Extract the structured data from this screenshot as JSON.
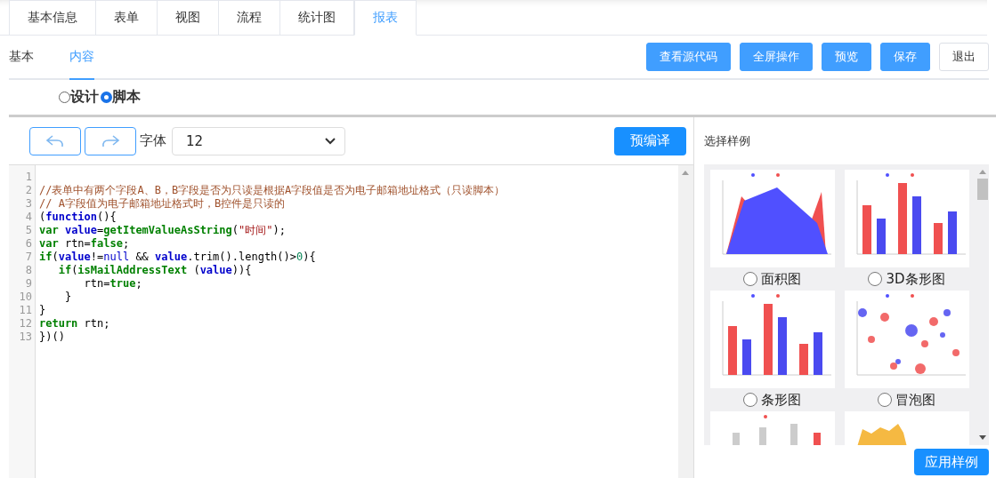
{
  "tabs": [
    {
      "label": "基本信息",
      "selected": false
    },
    {
      "label": "表单",
      "selected": false
    },
    {
      "label": "视图",
      "selected": false
    },
    {
      "label": "流程",
      "selected": false
    },
    {
      "label": "统计图",
      "selected": false
    },
    {
      "label": "报表",
      "selected": true
    }
  ],
  "subtabs": [
    {
      "label": "基本",
      "selected": false
    },
    {
      "label": "内容",
      "selected": true
    }
  ],
  "actions": [
    {
      "label": "查看源代码",
      "kind": "primary"
    },
    {
      "label": "全屏操作",
      "kind": "primary"
    },
    {
      "label": "预览",
      "kind": "primary"
    },
    {
      "label": "保存",
      "kind": "primary"
    },
    {
      "label": "退出",
      "kind": "plain"
    }
  ],
  "modes": [
    {
      "label": "设计",
      "selected": false
    },
    {
      "label": "脚本",
      "selected": true
    }
  ],
  "toolbar": {
    "font_label": "字体",
    "font_size": "12",
    "compile_button": "预编译"
  },
  "code": [
    {
      "line": "1"
    },
    {
      "line": "2",
      "tokens": [
        {
          "kind": "comment",
          "text": "//表单中有两个字段A、B，B字段是否为只读是根据A字段值是否为电子邮箱地址格式（只读脚本）"
        }
      ]
    },
    {
      "line": "3",
      "tokens": [
        {
          "kind": "comment",
          "text": "// A字段值为电子邮箱地址格式时，B控件是只读的"
        }
      ]
    },
    {
      "line": "4",
      "tokens": [
        {
          "kind": "plain",
          "text": "("
        },
        {
          "kind": "keyword",
          "text": "function"
        },
        {
          "kind": "plain",
          "text": "(){"
        }
      ]
    },
    {
      "line": "5",
      "tokens": [
        {
          "kind": "green",
          "text": "var "
        },
        {
          "kind": "keyword",
          "text": "value"
        },
        {
          "kind": "plain",
          "text": "="
        },
        {
          "kind": "green",
          "text": "getItemValueAsString"
        },
        {
          "kind": "plain",
          "text": "("
        },
        {
          "kind": "string",
          "text": "\"时间\""
        },
        {
          "kind": "plain",
          "text": ");"
        }
      ]
    },
    {
      "line": "6",
      "tokens": [
        {
          "kind": "green",
          "text": "var"
        },
        {
          "kind": "plain",
          "text": " rtn="
        },
        {
          "kind": "green",
          "text": "false"
        },
        {
          "kind": "plain",
          "text": ";"
        }
      ]
    },
    {
      "line": "7",
      "tokens": [
        {
          "kind": "green",
          "text": "if"
        },
        {
          "kind": "plain",
          "text": "("
        },
        {
          "kind": "keyword",
          "text": "value"
        },
        {
          "kind": "plain",
          "text": "!="
        },
        {
          "kind": "keyword2",
          "text": "null"
        },
        {
          "kind": "plain",
          "text": " && "
        },
        {
          "kind": "keyword",
          "text": "value"
        },
        {
          "kind": "plain",
          "text": ".trim().length()>"
        },
        {
          "kind": "number",
          "text": "0"
        },
        {
          "kind": "plain",
          "text": "){"
        }
      ]
    },
    {
      "line": "8",
      "tokens": [
        {
          "kind": "green",
          "text": "   if"
        },
        {
          "kind": "plain",
          "text": "("
        },
        {
          "kind": "green",
          "text": "isMailAddressText"
        },
        {
          "kind": "plain",
          "text": " ("
        },
        {
          "kind": "keyword",
          "text": "value"
        },
        {
          "kind": "plain",
          "text": ")){"
        }
      ]
    },
    {
      "line": "9",
      "tokens": [
        {
          "kind": "plain",
          "text": "       rtn="
        },
        {
          "kind": "green",
          "text": "true"
        },
        {
          "kind": "plain",
          "text": ";"
        }
      ]
    },
    {
      "line": "10",
      "tokens": [
        {
          "kind": "plain",
          "text": "    }"
        }
      ]
    },
    {
      "line": "11",
      "tokens": [
        {
          "kind": "plain",
          "text": "}"
        }
      ]
    },
    {
      "line": "12",
      "tokens": [
        {
          "kind": "green",
          "text": "return"
        },
        {
          "kind": "plain",
          "text": " rtn;"
        }
      ]
    },
    {
      "line": "13",
      "tokens": [
        {
          "kind": "plain",
          "text": "})()"
        }
      ]
    }
  ],
  "samples": {
    "title": "选择样例",
    "items": [
      {
        "kind": "area",
        "label": "面积图",
        "selected": false
      },
      {
        "kind": "bar3d",
        "label": "3D条形图",
        "selected": false
      },
      {
        "kind": "bar",
        "label": "条形图",
        "selected": false
      },
      {
        "kind": "bubble",
        "label": "冒泡图",
        "selected": false
      },
      {
        "kind": "boxbar"
      },
      {
        "kind": "linearea"
      }
    ],
    "apply_button": "应用样例"
  }
}
